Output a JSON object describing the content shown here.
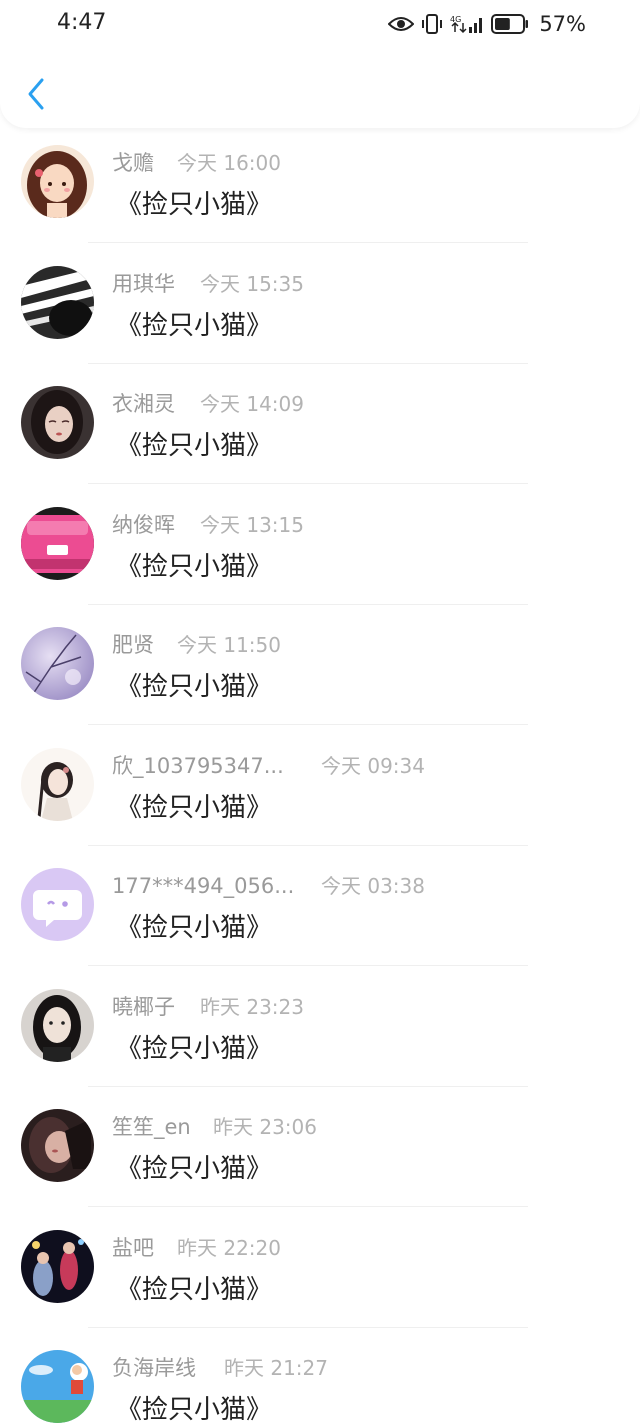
{
  "status_bar": {
    "time": "4:47",
    "network_label": "4G",
    "battery_percent": "57%",
    "battery_level": 0.57
  },
  "nav": {
    "back_icon": "chevron-left-icon",
    "accent_color": "#2aa0f0"
  },
  "messages": [
    {
      "name": "戈赡",
      "time": "今天 16:00",
      "text": "《捡只小猫》"
    },
    {
      "name": "用琪华",
      "time": "今天 15:35",
      "text": "《捡只小猫》"
    },
    {
      "name": "衣湘灵",
      "time": "今天 14:09",
      "text": "《捡只小猫》"
    },
    {
      "name": "纳俊晖",
      "time": "今天 13:15",
      "text": "《捡只小猫》"
    },
    {
      "name": "肥贤",
      "time": "今天 11:50",
      "text": "《捡只小猫》"
    },
    {
      "name": "欣_103795347...",
      "time": "今天 09:34",
      "text": "《捡只小猫》"
    },
    {
      "name": "177***494_056...",
      "time": "今天 03:38",
      "text": "《捡只小猫》"
    },
    {
      "name": "曉椰子",
      "time": "昨天 23:23",
      "text": "《捡只小猫》"
    },
    {
      "name": "笙笙_en",
      "time": "昨天 23:06",
      "text": "《捡只小猫》"
    },
    {
      "name": "盐吧",
      "time": "昨天 22:20",
      "text": "《捡只小猫》"
    },
    {
      "name": "负海岸线",
      "time": "昨天 21:27",
      "text": "《捡只小猫》"
    }
  ]
}
